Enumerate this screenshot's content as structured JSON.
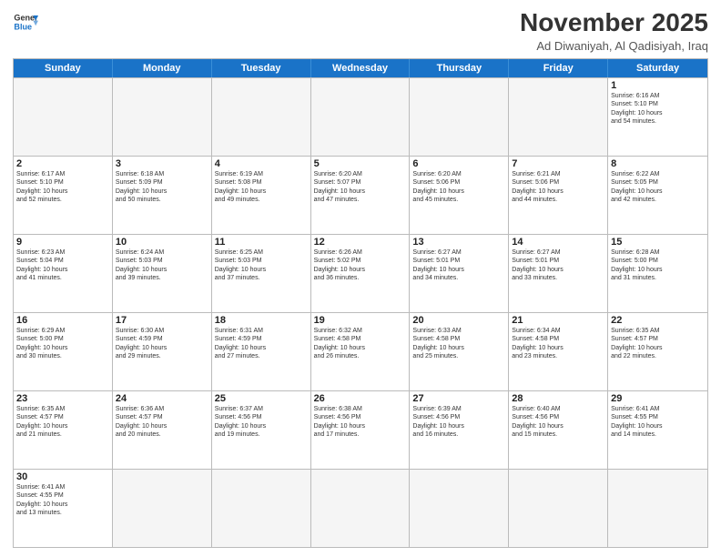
{
  "logo": {
    "line1": "General",
    "line2": "Blue"
  },
  "title": "November 2025",
  "subtitle": "Ad Diwaniyah, Al Qadisiyah, Iraq",
  "header_days": [
    "Sunday",
    "Monday",
    "Tuesday",
    "Wednesday",
    "Thursday",
    "Friday",
    "Saturday"
  ],
  "weeks": [
    [
      {
        "day": "",
        "info": "",
        "empty": true
      },
      {
        "day": "",
        "info": "",
        "empty": true
      },
      {
        "day": "",
        "info": "",
        "empty": true
      },
      {
        "day": "",
        "info": "",
        "empty": true
      },
      {
        "day": "",
        "info": "",
        "empty": true
      },
      {
        "day": "",
        "info": "",
        "empty": true
      },
      {
        "day": "1",
        "info": "Sunrise: 6:16 AM\nSunset: 5:10 PM\nDaylight: 10 hours\nand 54 minutes."
      }
    ],
    [
      {
        "day": "2",
        "info": "Sunrise: 6:17 AM\nSunset: 5:10 PM\nDaylight: 10 hours\nand 52 minutes."
      },
      {
        "day": "3",
        "info": "Sunrise: 6:18 AM\nSunset: 5:09 PM\nDaylight: 10 hours\nand 50 minutes."
      },
      {
        "day": "4",
        "info": "Sunrise: 6:19 AM\nSunset: 5:08 PM\nDaylight: 10 hours\nand 49 minutes."
      },
      {
        "day": "5",
        "info": "Sunrise: 6:20 AM\nSunset: 5:07 PM\nDaylight: 10 hours\nand 47 minutes."
      },
      {
        "day": "6",
        "info": "Sunrise: 6:20 AM\nSunset: 5:06 PM\nDaylight: 10 hours\nand 45 minutes."
      },
      {
        "day": "7",
        "info": "Sunrise: 6:21 AM\nSunset: 5:06 PM\nDaylight: 10 hours\nand 44 minutes."
      },
      {
        "day": "8",
        "info": "Sunrise: 6:22 AM\nSunset: 5:05 PM\nDaylight: 10 hours\nand 42 minutes."
      }
    ],
    [
      {
        "day": "9",
        "info": "Sunrise: 6:23 AM\nSunset: 5:04 PM\nDaylight: 10 hours\nand 41 minutes."
      },
      {
        "day": "10",
        "info": "Sunrise: 6:24 AM\nSunset: 5:03 PM\nDaylight: 10 hours\nand 39 minutes."
      },
      {
        "day": "11",
        "info": "Sunrise: 6:25 AM\nSunset: 5:03 PM\nDaylight: 10 hours\nand 37 minutes."
      },
      {
        "day": "12",
        "info": "Sunrise: 6:26 AM\nSunset: 5:02 PM\nDaylight: 10 hours\nand 36 minutes."
      },
      {
        "day": "13",
        "info": "Sunrise: 6:27 AM\nSunset: 5:01 PM\nDaylight: 10 hours\nand 34 minutes."
      },
      {
        "day": "14",
        "info": "Sunrise: 6:27 AM\nSunset: 5:01 PM\nDaylight: 10 hours\nand 33 minutes."
      },
      {
        "day": "15",
        "info": "Sunrise: 6:28 AM\nSunset: 5:00 PM\nDaylight: 10 hours\nand 31 minutes."
      }
    ],
    [
      {
        "day": "16",
        "info": "Sunrise: 6:29 AM\nSunset: 5:00 PM\nDaylight: 10 hours\nand 30 minutes."
      },
      {
        "day": "17",
        "info": "Sunrise: 6:30 AM\nSunset: 4:59 PM\nDaylight: 10 hours\nand 29 minutes."
      },
      {
        "day": "18",
        "info": "Sunrise: 6:31 AM\nSunset: 4:59 PM\nDaylight: 10 hours\nand 27 minutes."
      },
      {
        "day": "19",
        "info": "Sunrise: 6:32 AM\nSunset: 4:58 PM\nDaylight: 10 hours\nand 26 minutes."
      },
      {
        "day": "20",
        "info": "Sunrise: 6:33 AM\nSunset: 4:58 PM\nDaylight: 10 hours\nand 25 minutes."
      },
      {
        "day": "21",
        "info": "Sunrise: 6:34 AM\nSunset: 4:58 PM\nDaylight: 10 hours\nand 23 minutes."
      },
      {
        "day": "22",
        "info": "Sunrise: 6:35 AM\nSunset: 4:57 PM\nDaylight: 10 hours\nand 22 minutes."
      }
    ],
    [
      {
        "day": "23",
        "info": "Sunrise: 6:35 AM\nSunset: 4:57 PM\nDaylight: 10 hours\nand 21 minutes."
      },
      {
        "day": "24",
        "info": "Sunrise: 6:36 AM\nSunset: 4:57 PM\nDaylight: 10 hours\nand 20 minutes."
      },
      {
        "day": "25",
        "info": "Sunrise: 6:37 AM\nSunset: 4:56 PM\nDaylight: 10 hours\nand 19 minutes."
      },
      {
        "day": "26",
        "info": "Sunrise: 6:38 AM\nSunset: 4:56 PM\nDaylight: 10 hours\nand 17 minutes."
      },
      {
        "day": "27",
        "info": "Sunrise: 6:39 AM\nSunset: 4:56 PM\nDaylight: 10 hours\nand 16 minutes."
      },
      {
        "day": "28",
        "info": "Sunrise: 6:40 AM\nSunset: 4:56 PM\nDaylight: 10 hours\nand 15 minutes."
      },
      {
        "day": "29",
        "info": "Sunrise: 6:41 AM\nSunset: 4:55 PM\nDaylight: 10 hours\nand 14 minutes."
      }
    ],
    [
      {
        "day": "30",
        "info": "Sunrise: 6:41 AM\nSunset: 4:55 PM\nDaylight: 10 hours\nand 13 minutes."
      },
      {
        "day": "",
        "info": "",
        "empty": true
      },
      {
        "day": "",
        "info": "",
        "empty": true
      },
      {
        "day": "",
        "info": "",
        "empty": true
      },
      {
        "day": "",
        "info": "",
        "empty": true
      },
      {
        "day": "",
        "info": "",
        "empty": true
      },
      {
        "day": "",
        "info": "",
        "empty": true
      }
    ]
  ]
}
